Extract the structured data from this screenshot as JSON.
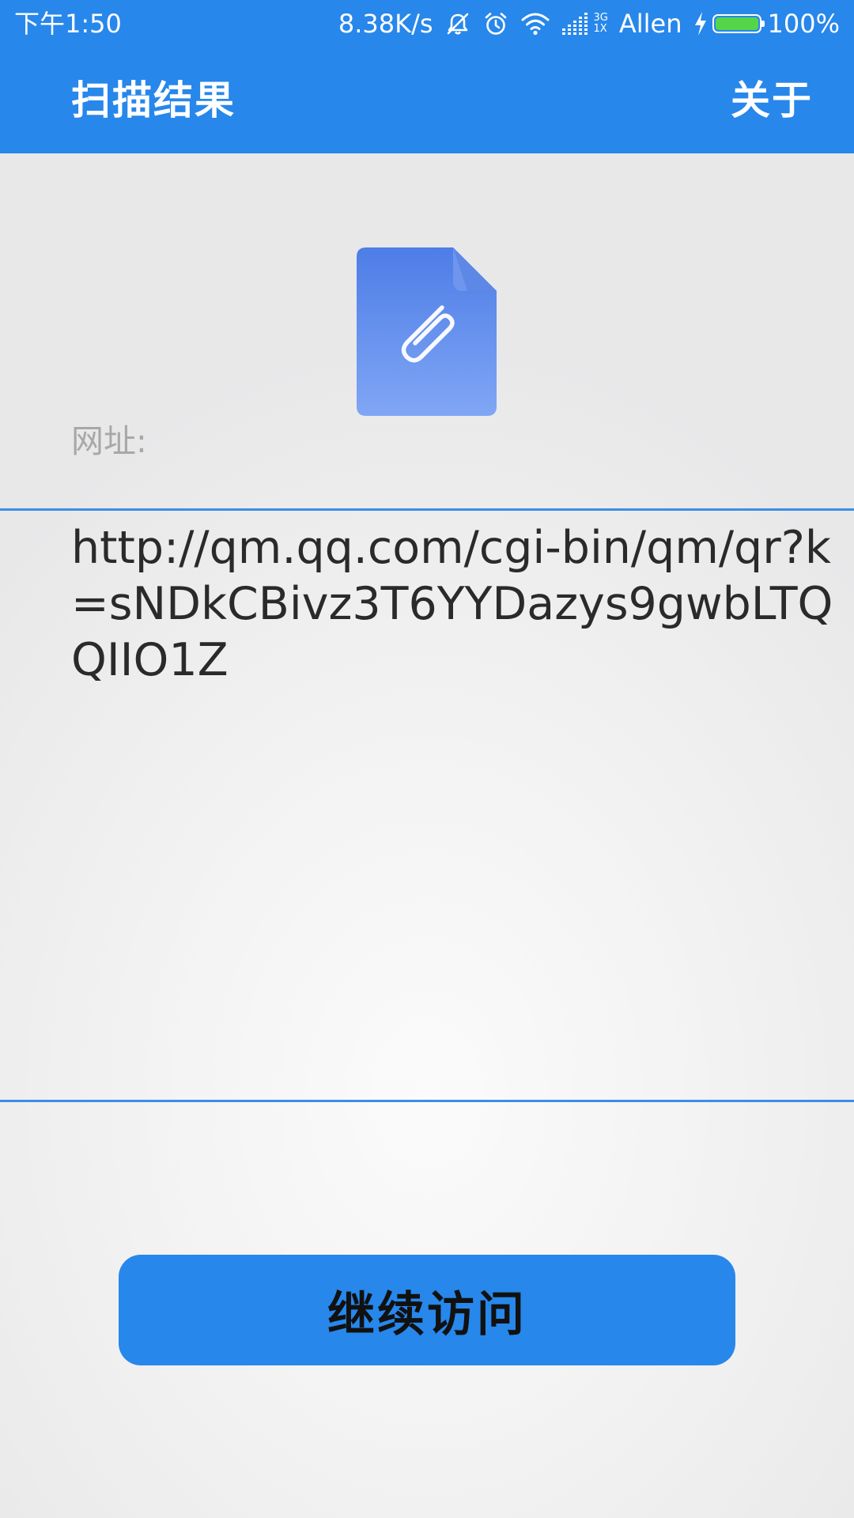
{
  "status_bar": {
    "time": "下午1:50",
    "net_speed": "8.38K/s",
    "net_type_top": "3G",
    "net_type_bottom": "1X",
    "carrier": "Allen",
    "battery_percent_text": "100%",
    "battery_level": 1.0
  },
  "toolbar": {
    "title": "扫描结果",
    "about_label": "关于"
  },
  "content": {
    "file_icon": "paperclip-file-icon",
    "url_label": "网址:",
    "url_value": "http://qm.qq.com/cgi-bin/qm/qr?k=sNDkCBivz3T6YYDazys9gwbLTQQIIO1Z"
  },
  "actions": {
    "continue_label": "继续访问"
  },
  "colors": {
    "primary": "#2787eb",
    "divider": "#3a8ee6",
    "label_gray": "#a8a8a8",
    "text_dark": "#2a2a2a",
    "battery_green": "#55d64a"
  }
}
